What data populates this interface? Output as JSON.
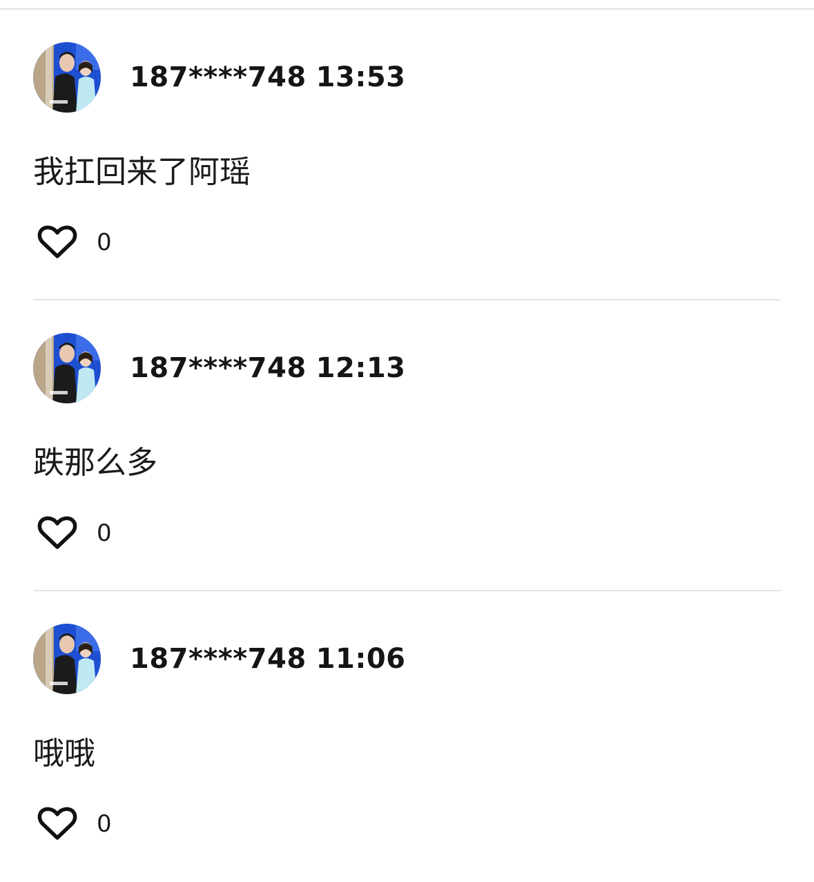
{
  "comments": [
    {
      "user": "187****748",
      "time": "13:53",
      "text": "我扛回来了阿瑶",
      "likes": "0"
    },
    {
      "user": "187****748",
      "time": "12:13",
      "text": "跌那么多",
      "likes": "0"
    },
    {
      "user": "187****748",
      "time": "11:06",
      "text": "哦哦",
      "likes": "0"
    }
  ],
  "icons": {
    "like": "heart-outline-icon",
    "avatar": "user-photo-avatar"
  },
  "colors": {
    "text": "#111111",
    "divider": "#e4e4e4",
    "avatar_bg": "#1f4fd1"
  }
}
